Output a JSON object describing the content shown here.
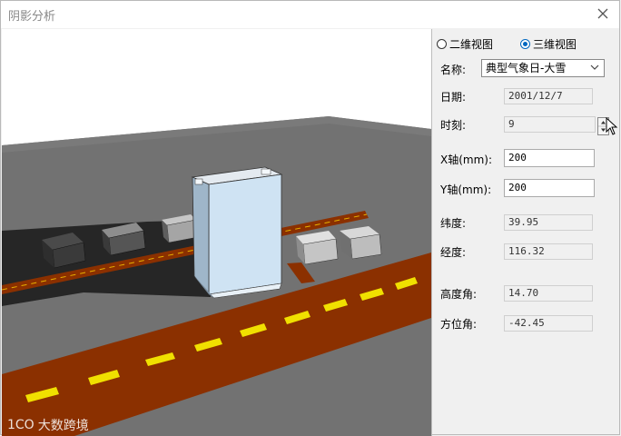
{
  "window": {
    "title": "阴影分析"
  },
  "view_mode": {
    "options": [
      {
        "label": "二维视图",
        "selected": false
      },
      {
        "label": "三维视图",
        "selected": true
      }
    ]
  },
  "fields": {
    "name": {
      "label": "名称:",
      "value": "典型气象日-大雪"
    },
    "date": {
      "label": "日期:",
      "value": "2001/12/7"
    },
    "time": {
      "label": "时刻:",
      "value": "9"
    },
    "x_axis": {
      "label": "X轴(mm):",
      "value": "200"
    },
    "y_axis": {
      "label": "Y轴(mm):",
      "value": "200"
    },
    "latitude": {
      "label": "纬度:",
      "value": "39.95"
    },
    "longitude": {
      "label": "经度:",
      "value": "116.32"
    },
    "altitude": {
      "label": "高度角:",
      "value": "14.70"
    },
    "azimuth": {
      "label": "方位角:",
      "value": "-42.45"
    }
  },
  "watermark": {
    "text": "大数跨境",
    "logo": "1CO"
  },
  "icons": {
    "close": "close-icon",
    "dropdown": "chevron-down-icon",
    "spinner": "spinner-arrows-icon"
  },
  "colors": {
    "road": "#8b3000",
    "stripe": "#f0e000",
    "ground": "#727272",
    "building": "#cfe3f3"
  }
}
